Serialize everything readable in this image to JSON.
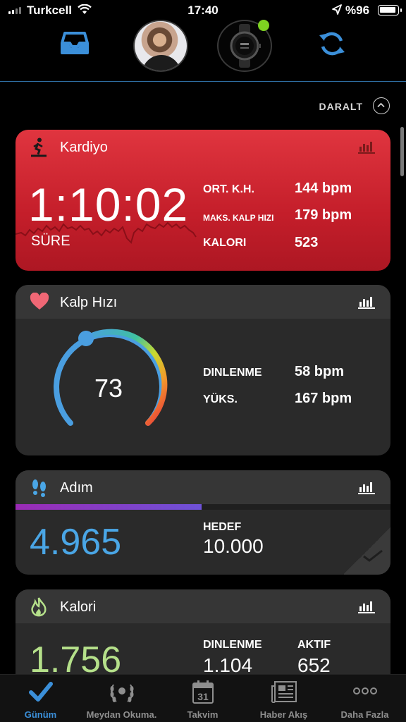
{
  "status_bar": {
    "carrier": "Turkcell",
    "time": "17:40",
    "battery": "%96"
  },
  "header": {
    "collapse_label": "DARALT"
  },
  "cardio": {
    "title": "Kardiyo",
    "duration": "1:10:02",
    "duration_label": "SÜRE",
    "stats": [
      {
        "label": "ORT. K.H.",
        "value": "144 bpm"
      },
      {
        "label": "MAKS. KALP HIZI",
        "value": "179 bpm"
      },
      {
        "label": "KALORI",
        "value": "523"
      }
    ]
  },
  "heart_rate": {
    "title": "Kalp Hızı",
    "current": "73",
    "level": 0.27,
    "stats": [
      {
        "label": "DINLENME",
        "value": "58 bpm"
      },
      {
        "label": "YÜKS.",
        "value": "167 bpm"
      }
    ]
  },
  "steps": {
    "title": "Adım",
    "value": "4.965",
    "goal_label": "HEDEF",
    "goal_value": "10.000",
    "progress": 0.4965
  },
  "calories": {
    "title": "Kalori",
    "value": "1.756",
    "resting_label": "DINLENME",
    "resting_value": "1.104",
    "active_label": "AKTIF",
    "active_value": "652"
  },
  "tabs": [
    {
      "label": "Günüm",
      "icon": "check-icon",
      "active": true
    },
    {
      "label": "Meydan Okuma.",
      "icon": "laurel-icon",
      "active": false
    },
    {
      "label": "Takvim",
      "icon": "calendar-icon",
      "date": "31",
      "active": false
    },
    {
      "label": "Haber Akış",
      "icon": "news-icon",
      "active": false
    },
    {
      "label": "Daha Fazla",
      "icon": "more-icon",
      "active": false
    }
  ],
  "colors": {
    "accent": "#3b8fd9",
    "cardio_red": "#d62a36",
    "steps_blue": "#4aa6e6",
    "calorie_green": "#b5e08a",
    "watch_status": "#7ed321"
  }
}
